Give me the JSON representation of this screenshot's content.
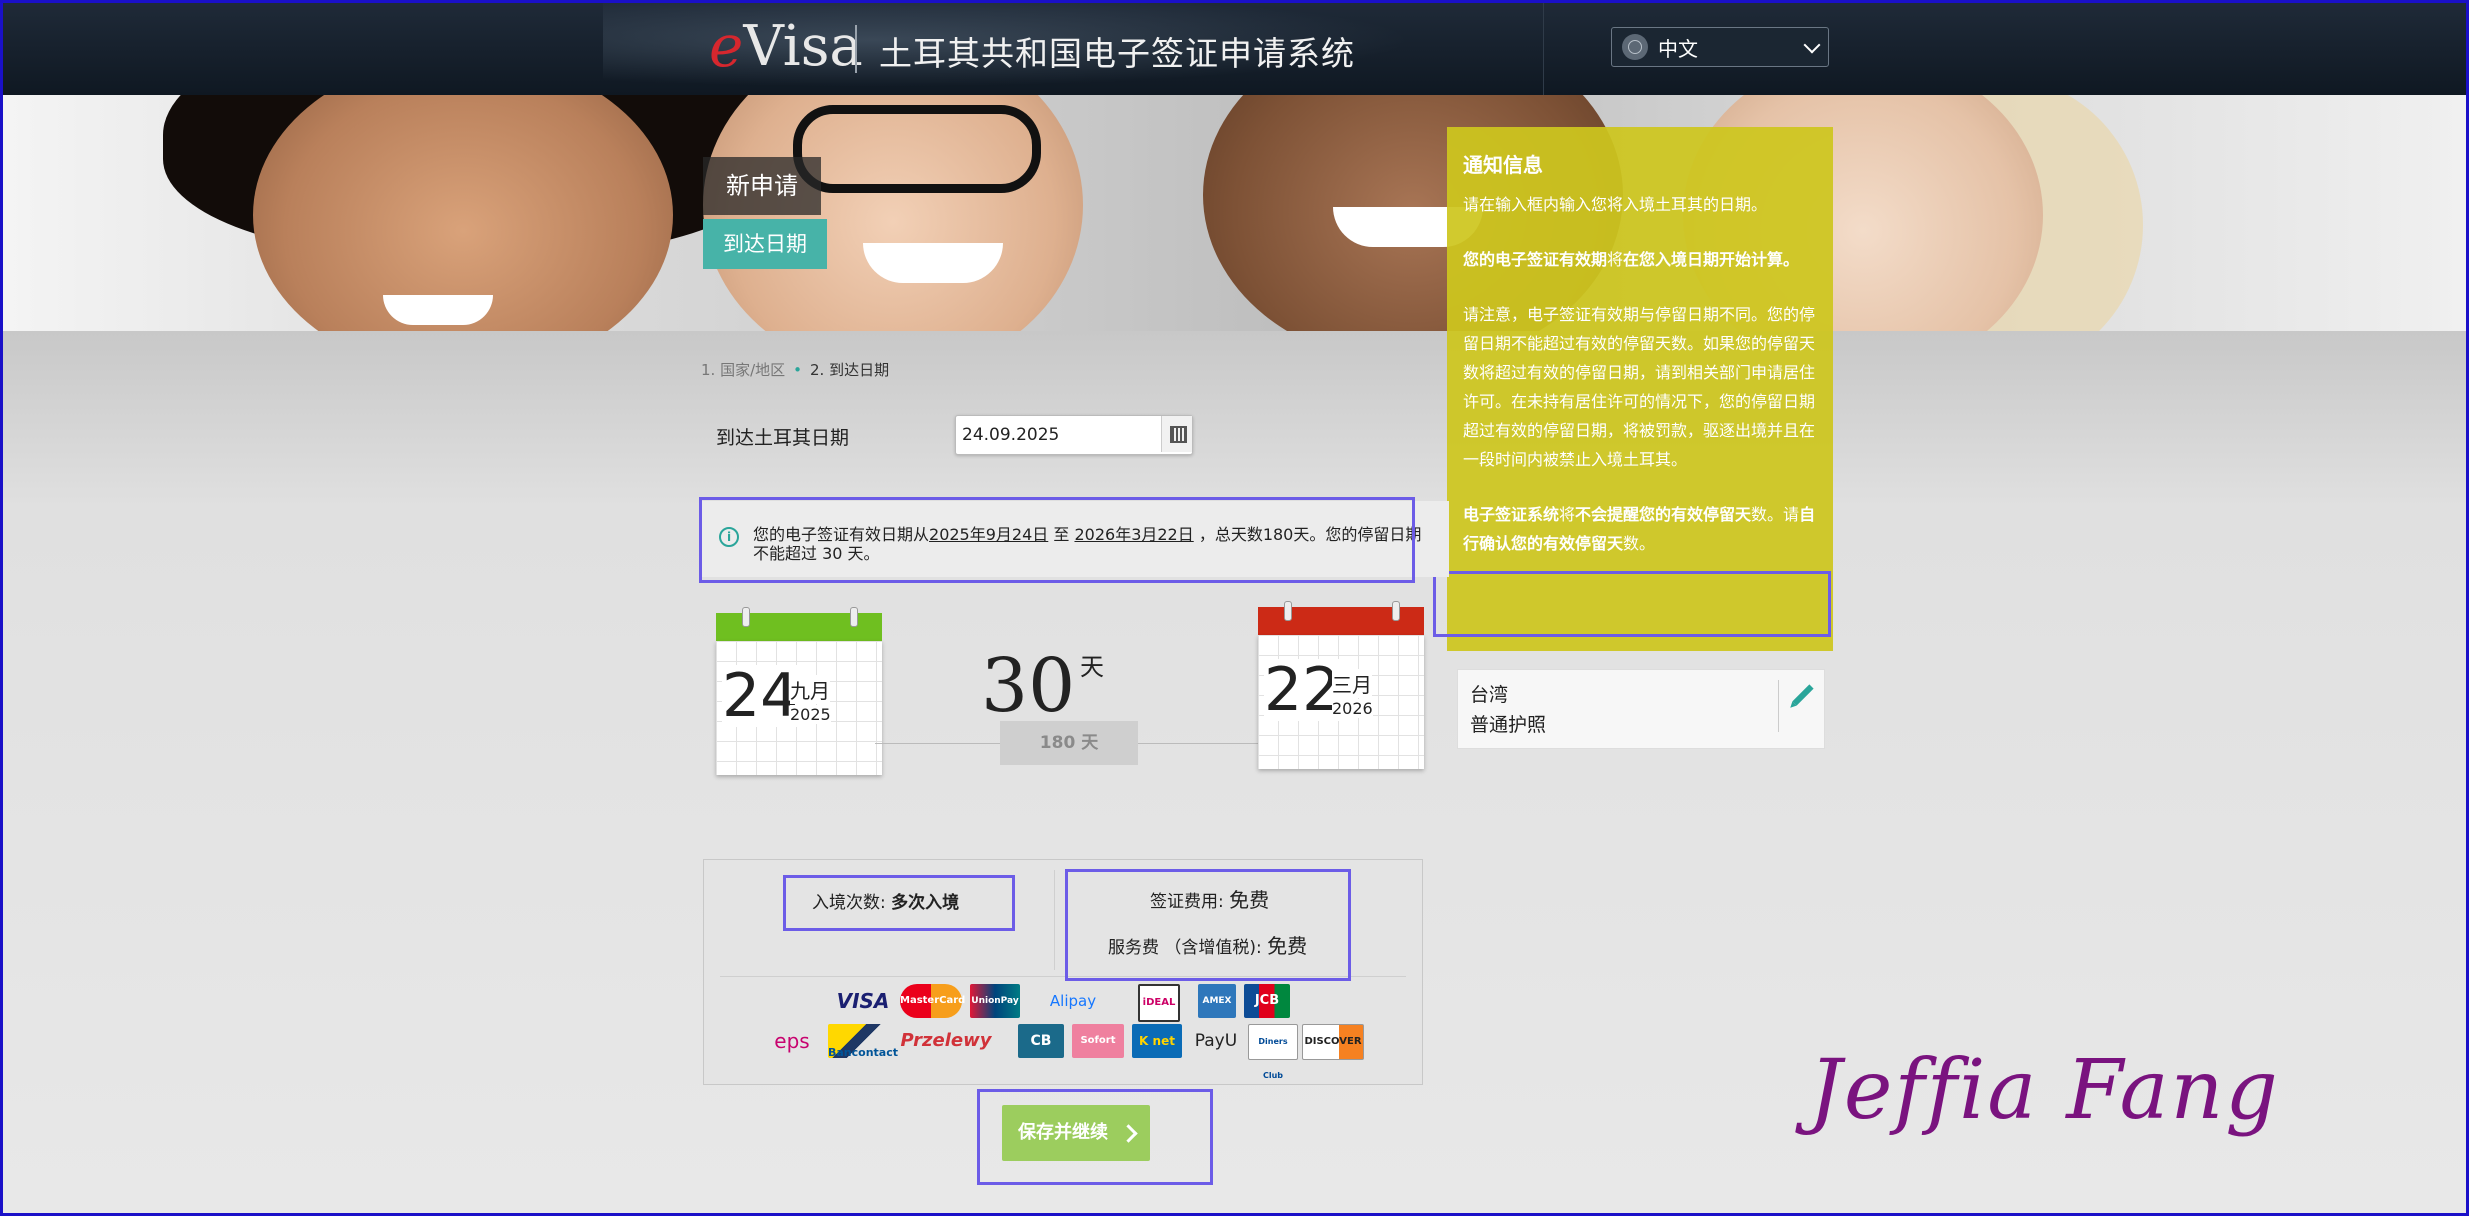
{
  "header": {
    "logo_e": "e",
    "logo_visa": "Visa",
    "system_title": "土耳其共和国电子签证申请系统",
    "language": "中文"
  },
  "banner": {
    "tag_new": "新申请",
    "tag_arrival": "到达日期"
  },
  "notice": {
    "title": "通知信息",
    "p1": "请在输入框内输入您将入境土耳其的日期。",
    "p2_bold1": "您的电子签证有效期",
    "p2_mid": "将",
    "p2_bold2": "在您入境日期开始计算。",
    "p3": "请注意，电子签证有效期与停留日期不同。您的停留日期不能超过有效的停留天数。如果您的停留天数将超过有效的停留日期，请到相关部门申请居住许可。在未持有居住许可的情况下，您的停留日期超过有效的停留日期，将被罚款，驱逐出境并且在一段时间内被禁止入境土耳其。",
    "p4_bold1": "电子签证系统",
    "p4_mid1": "将",
    "p4_bold2": "不会提醒您的有效停留天",
    "p4_mid2": "数。请",
    "p4_bold3": "自行确认您的有效停留天",
    "p4_end": "数。"
  },
  "breadcrumb": {
    "step1": "1. 国家/地区",
    "step2": "2. 到达日期"
  },
  "arrival": {
    "label": "到达土耳其日期",
    "value": "24.09.2025"
  },
  "info": {
    "icon": "i",
    "pre": "您的电子签证有效日期从",
    "from": "2025年9月24日",
    "mid": " 至 ",
    "to": "2026年3月22日",
    "post": " ，总天数180天。您的停留日期不能超过 30 天。"
  },
  "calendar_start": {
    "day": "24",
    "month": "九月",
    "year": "2025"
  },
  "calendar_end": {
    "day": "22",
    "month": "三月",
    "year": "2026"
  },
  "stay": {
    "days": "30",
    "unit": "天",
    "total": "180 天"
  },
  "passport": {
    "country": "台湾",
    "type": "普通护照"
  },
  "fees": {
    "entry_label": "入境次数: ",
    "entry_value": "多次入境",
    "visa_fee_label": "签证费用: ",
    "visa_fee_value": "免费",
    "service_fee_label": "服务费 （含增值税): ",
    "service_fee_value": "免费"
  },
  "payment_methods": {
    "row1": [
      "VISA",
      "MasterCard",
      "UnionPay",
      "Alipay",
      "iDEAL",
      "AMEX",
      "JCB"
    ],
    "row2": [
      "eps",
      "Bancontact",
      "Przelewy",
      "CB",
      "Sofort",
      "K net",
      "PayU",
      "Diners Club",
      "DISCOVER"
    ]
  },
  "actions": {
    "save": "保存并继续"
  },
  "signature": "Jeffia Fang",
  "colors": {
    "notice_bg": "#cdc61e",
    "accent_teal": "#2aa59a",
    "save_button": "#9ccd5e",
    "highlight_border": "#6c5ce7"
  }
}
